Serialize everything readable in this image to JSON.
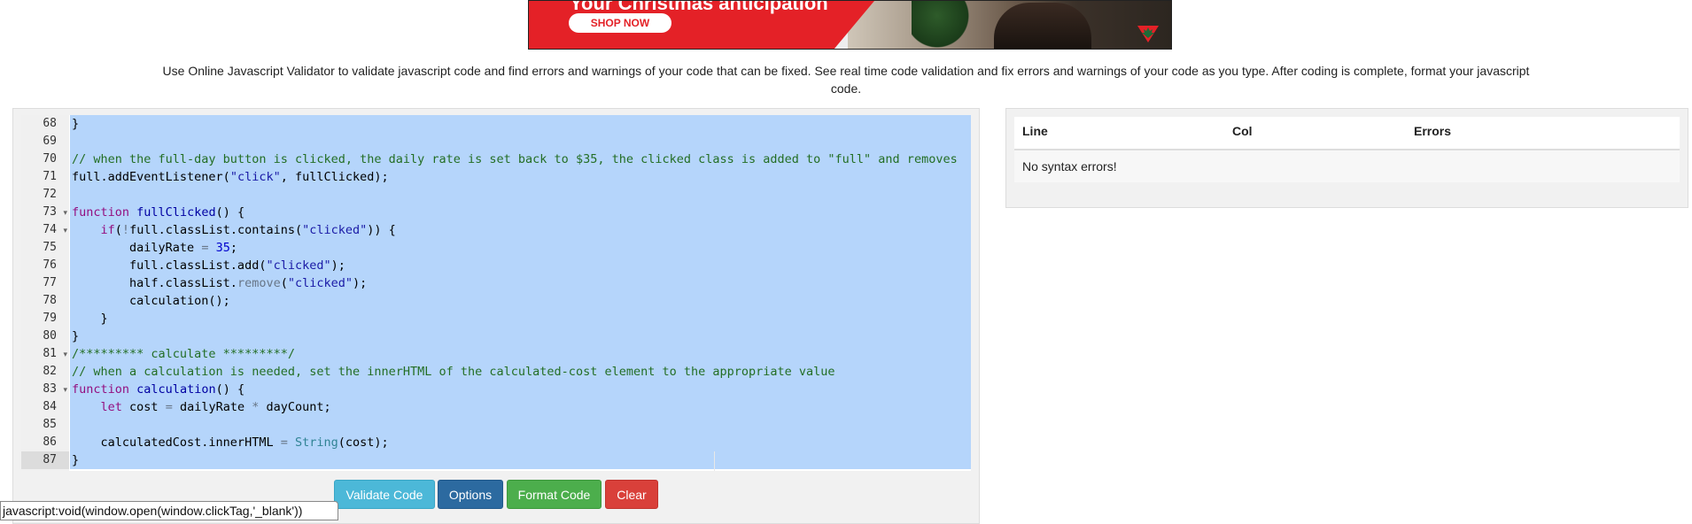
{
  "ad": {
    "headline": "Your Christmas anticipation",
    "shop_button": "SHOP NOW"
  },
  "description": "Use Online Javascript Validator to validate javascript code and find errors and warnings of your code that can be fixed. See real time code validation and fix errors and warnings of your code as you type. After coding is complete, format your javascript code.",
  "editor": {
    "lines": [
      {
        "n": "68",
        "fold": "",
        "html": "}"
      },
      {
        "n": "69",
        "fold": "",
        "html": ""
      },
      {
        "n": "70",
        "fold": "",
        "html": "<span class=\"c-com\">// when the full-day button is clicked, the daily rate is set back to $35, the clicked class is added to \"full\" and removes</span>"
      },
      {
        "n": "71",
        "fold": "",
        "html": "full.addEventListener(<span class=\"c-str\">\"click\"</span>, fullClicked);"
      },
      {
        "n": "72",
        "fold": "",
        "html": ""
      },
      {
        "n": "73",
        "fold": "▾",
        "html": "<span class=\"c-kw\">function</span> <span class=\"c-fn\">fullClicked</span>() {"
      },
      {
        "n": "74",
        "fold": "▾",
        "html": "    <span class=\"c-kw\">if</span>(<span class=\"c-op\">!</span>full.classList.contains(<span class=\"c-str\">\"clicked\"</span>)) {"
      },
      {
        "n": "75",
        "fold": "",
        "html": "        dailyRate <span class=\"c-op\">=</span> <span class=\"c-num\">35</span>;"
      },
      {
        "n": "76",
        "fold": "",
        "html": "        full.classList.add(<span class=\"c-str\">\"clicked\"</span>);"
      },
      {
        "n": "77",
        "fold": "",
        "html": "        half.classList.<span class=\"c-op\">remove</span>(<span class=\"c-str\">\"clicked\"</span>);"
      },
      {
        "n": "78",
        "fold": "",
        "html": "        calculation();"
      },
      {
        "n": "79",
        "fold": "",
        "html": "    }"
      },
      {
        "n": "80",
        "fold": "",
        "html": "}"
      },
      {
        "n": "81",
        "fold": "▾",
        "html": "<span class=\"c-com\">/********* calculate *********/</span>"
      },
      {
        "n": "82",
        "fold": "",
        "html": "<span class=\"c-com\">// when a calculation is needed, set the innerHTML of the calculated-cost element to the appropriate value</span>"
      },
      {
        "n": "83",
        "fold": "▾",
        "html": "<span class=\"c-kw\">function</span> <span class=\"c-fn\">calculation</span>() {"
      },
      {
        "n": "84",
        "fold": "",
        "html": "    <span class=\"c-kw\">let</span> cost <span class=\"c-op\">=</span> dailyRate <span class=\"c-op\">*</span> dayCount;"
      },
      {
        "n": "85",
        "fold": "",
        "html": ""
      },
      {
        "n": "86",
        "fold": "",
        "html": "    calculatedCost.innerHTML <span class=\"c-op\">=</span> <span class=\"c-sup\">String</span>(cost);"
      },
      {
        "n": "87",
        "fold": "",
        "html": "}"
      }
    ],
    "active_line": "87"
  },
  "buttons": {
    "validate": "Validate Code",
    "options": "Options",
    "format": "Format Code",
    "clear": "Clear"
  },
  "status_url": "javascript:void(window.open(window.clickTag,'_blank'))",
  "results": {
    "headers": [
      "Line",
      "Col",
      "Errors"
    ],
    "message": "No syntax errors!"
  },
  "colors": {
    "selection": "#b5d5fb",
    "ad_red": "#e42127",
    "validate_btn": "#4cb8d8",
    "options_btn": "#2c6aa0",
    "format_btn": "#4cae4c",
    "clear_btn": "#d9403a"
  }
}
